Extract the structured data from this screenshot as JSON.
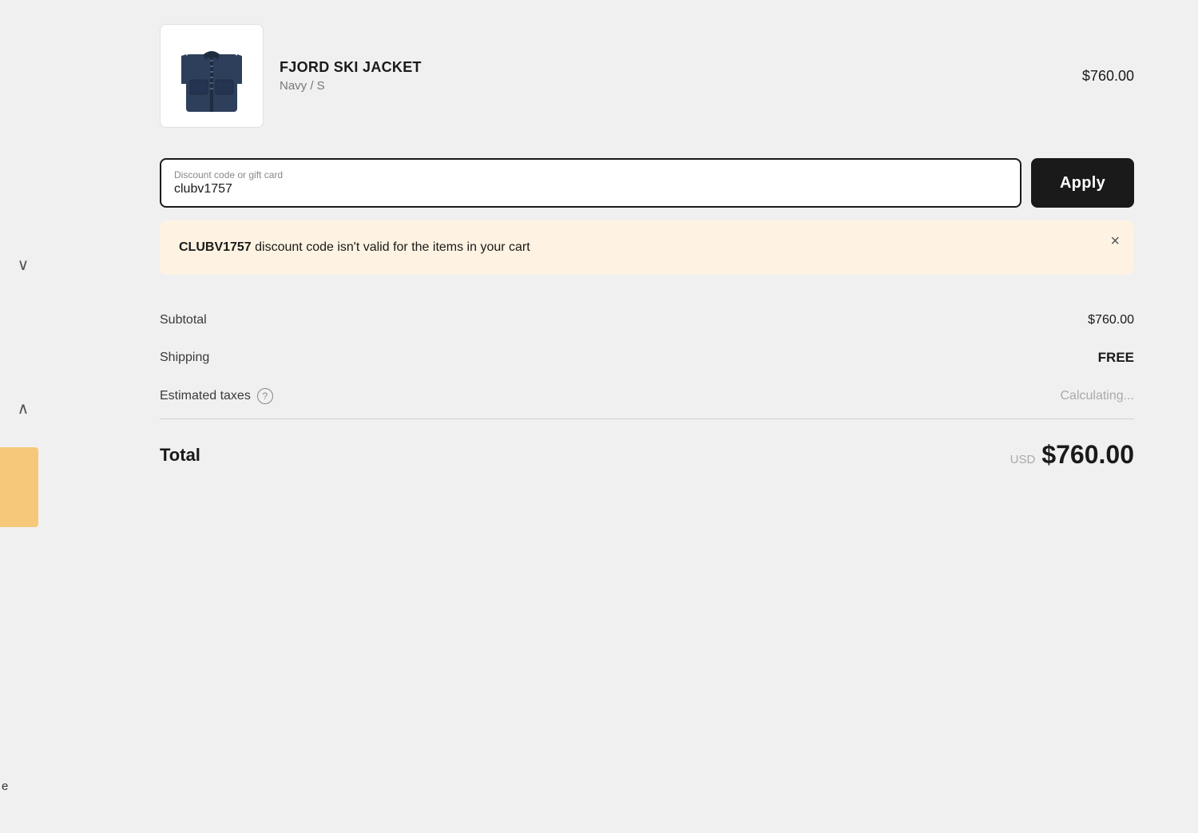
{
  "product": {
    "name": "FJORD SKI JACKET",
    "variant": "Navy / S",
    "price": "$760.00",
    "image_alt": "Navy ski jacket product image"
  },
  "discount": {
    "input_label": "Discount code or gift card",
    "input_value": "clubv1757",
    "apply_button_label": "Apply"
  },
  "error": {
    "code": "CLUBV1757",
    "message_suffix": " discount code isn't valid for the items in your cart",
    "close_icon": "×"
  },
  "order_summary": {
    "subtotal_label": "Subtotal",
    "subtotal_value": "$760.00",
    "shipping_label": "Shipping",
    "shipping_value": "FREE",
    "taxes_label": "Estimated taxes",
    "taxes_value": "Calculating...",
    "total_label": "Total",
    "total_currency": "USD",
    "total_amount": "$760.00"
  },
  "nav": {
    "chevron_up": "∧",
    "chevron_down": "∨"
  },
  "edge": {
    "text": "e"
  }
}
